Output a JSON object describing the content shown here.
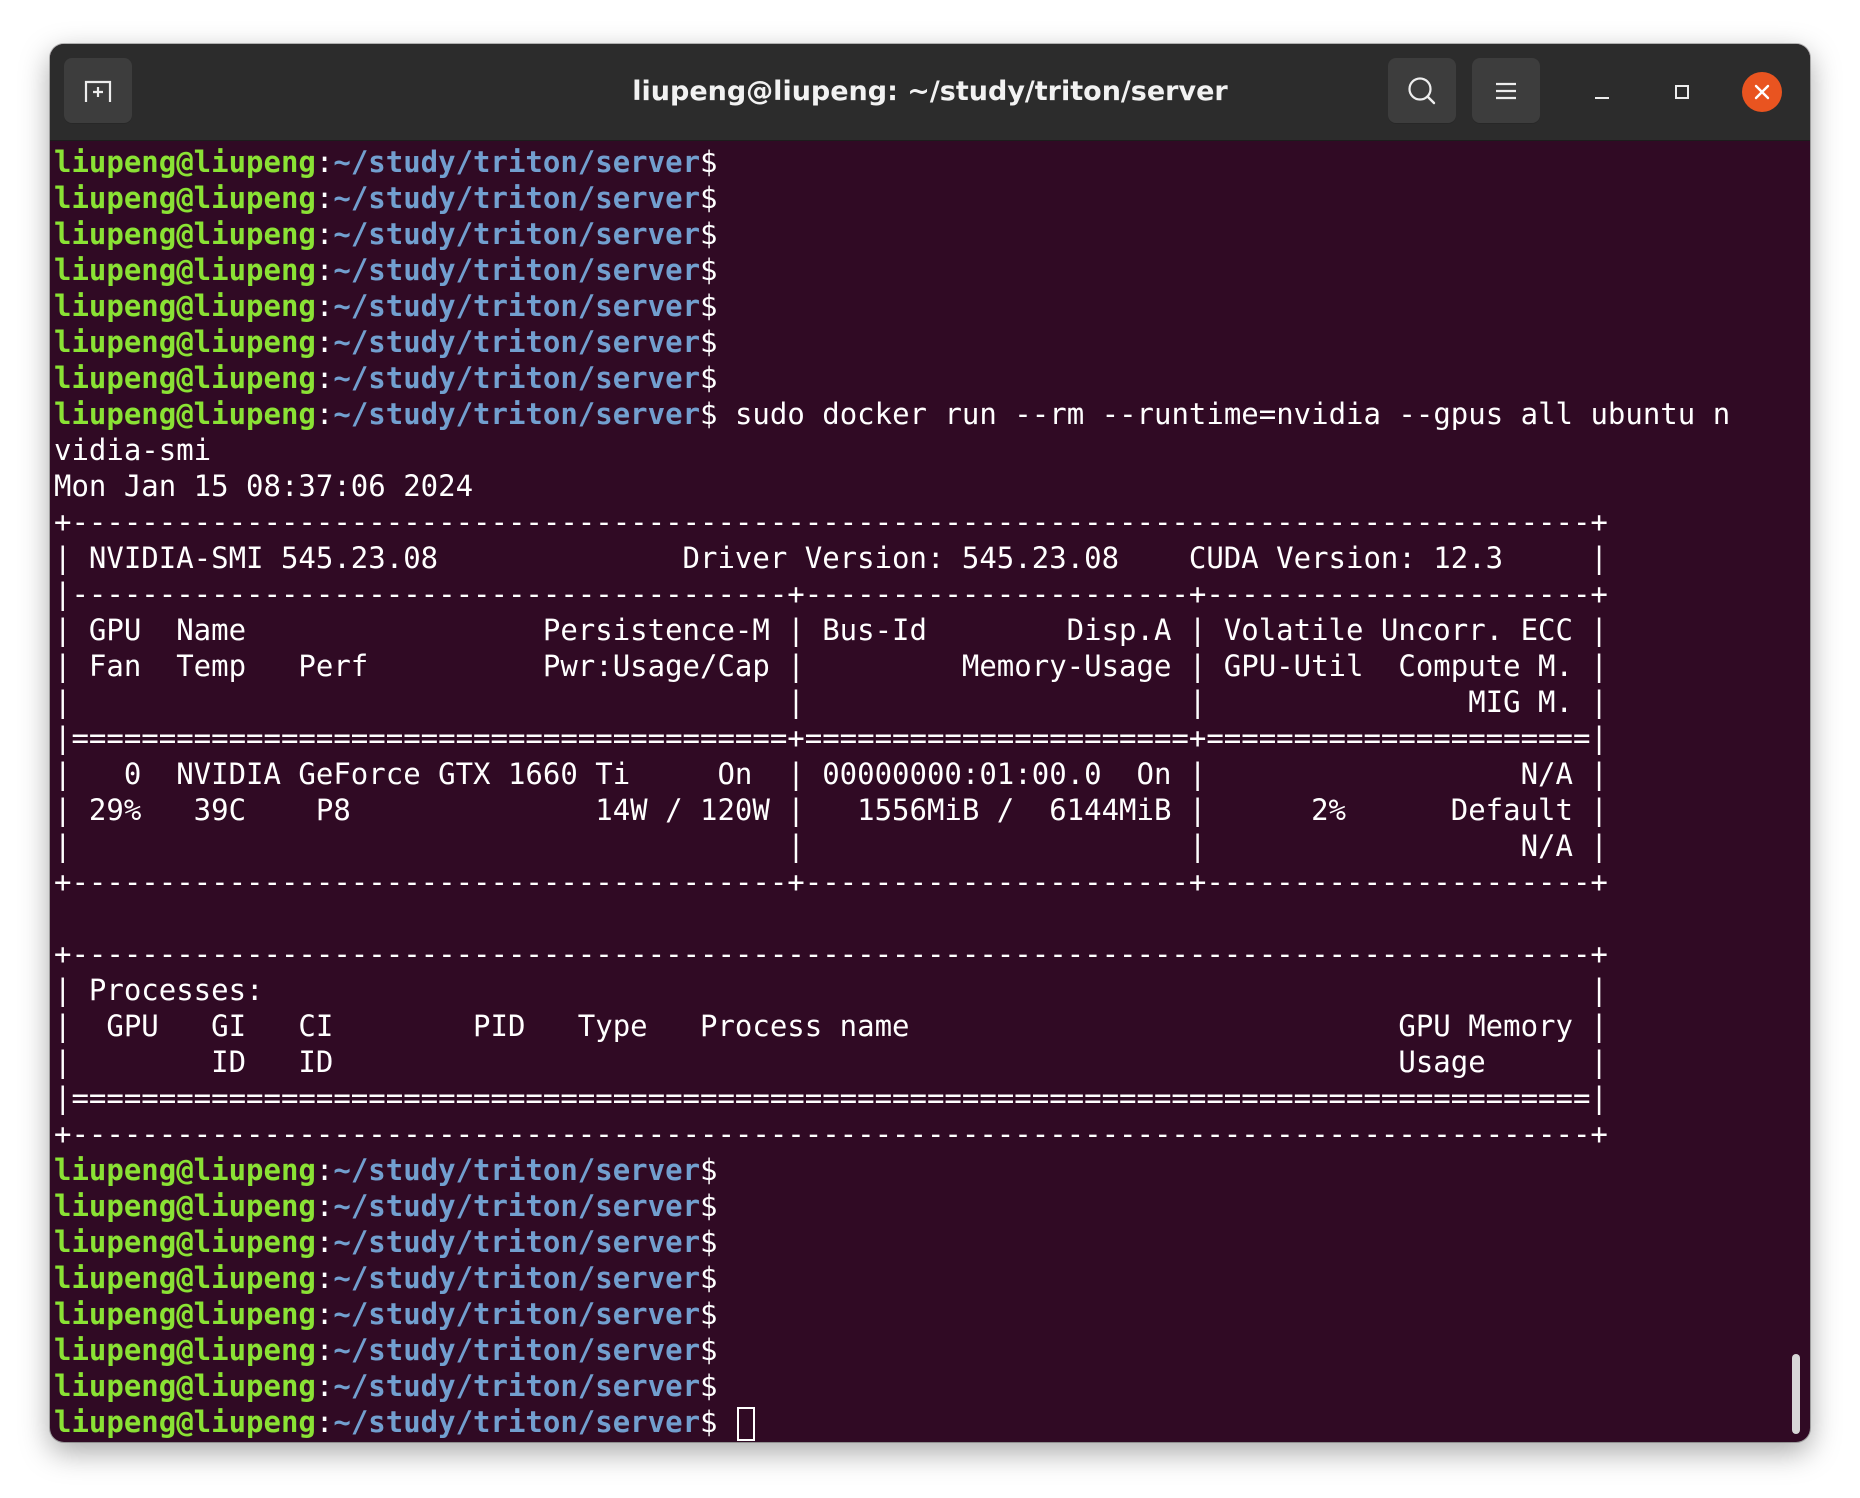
{
  "window": {
    "title": "liupeng@liupeng: ~/study/triton/server"
  },
  "titlebar": {
    "new_tab_icon": "new-tab-icon",
    "search_icon": "search-icon",
    "menu_icon": "hamburger-menu-icon",
    "minimize_icon": "minimize-icon",
    "maximize_icon": "maximize-icon",
    "close_icon": "close-icon"
  },
  "colors": {
    "terminal_bg": "#300a24",
    "prompt_user": "#8ae234",
    "prompt_path": "#729fcf",
    "titlebar_bg": "#2c2c2c",
    "close_button": "#e95420"
  },
  "prompt": {
    "user": "liupeng@liupeng",
    "sep": ":",
    "path": "~/study/triton/server",
    "symbol": "$"
  },
  "command": {
    "text": " sudo docker run --rm --runtime=nvidia --gpus all ubuntu n",
    "wrap": "vidia-smi"
  },
  "output_lines": [
    "Mon Jan 15 08:37:06 2024",
    "+---------------------------------------------------------------------------------------+",
    "| NVIDIA-SMI 545.23.08              Driver Version: 545.23.08    CUDA Version: 12.3     |",
    "|-----------------------------------------+----------------------+----------------------+",
    "| GPU  Name                 Persistence-M | Bus-Id        Disp.A | Volatile Uncorr. ECC |",
    "| Fan  Temp   Perf          Pwr:Usage/Cap |         Memory-Usage | GPU-Util  Compute M. |",
    "|                                         |                      |               MIG M. |",
    "|=========================================+======================+======================|",
    "|   0  NVIDIA GeForce GTX 1660 Ti     On  | 00000000:01:00.0  On |                  N/A |",
    "| 29%   39C    P8              14W / 120W |   1556MiB /  6144MiB |      2%      Default |",
    "|                                         |                      |                  N/A |",
    "+-----------------------------------------+----------------------+----------------------+",
    "",
    "+---------------------------------------------------------------------------------------+",
    "| Processes:                                                                            |",
    "|  GPU   GI   CI        PID   Type   Process name                            GPU Memory |",
    "|        ID   ID                                                             Usage      |",
    "|=======================================================================================|",
    "+---------------------------------------------------------------------------------------+"
  ]
}
